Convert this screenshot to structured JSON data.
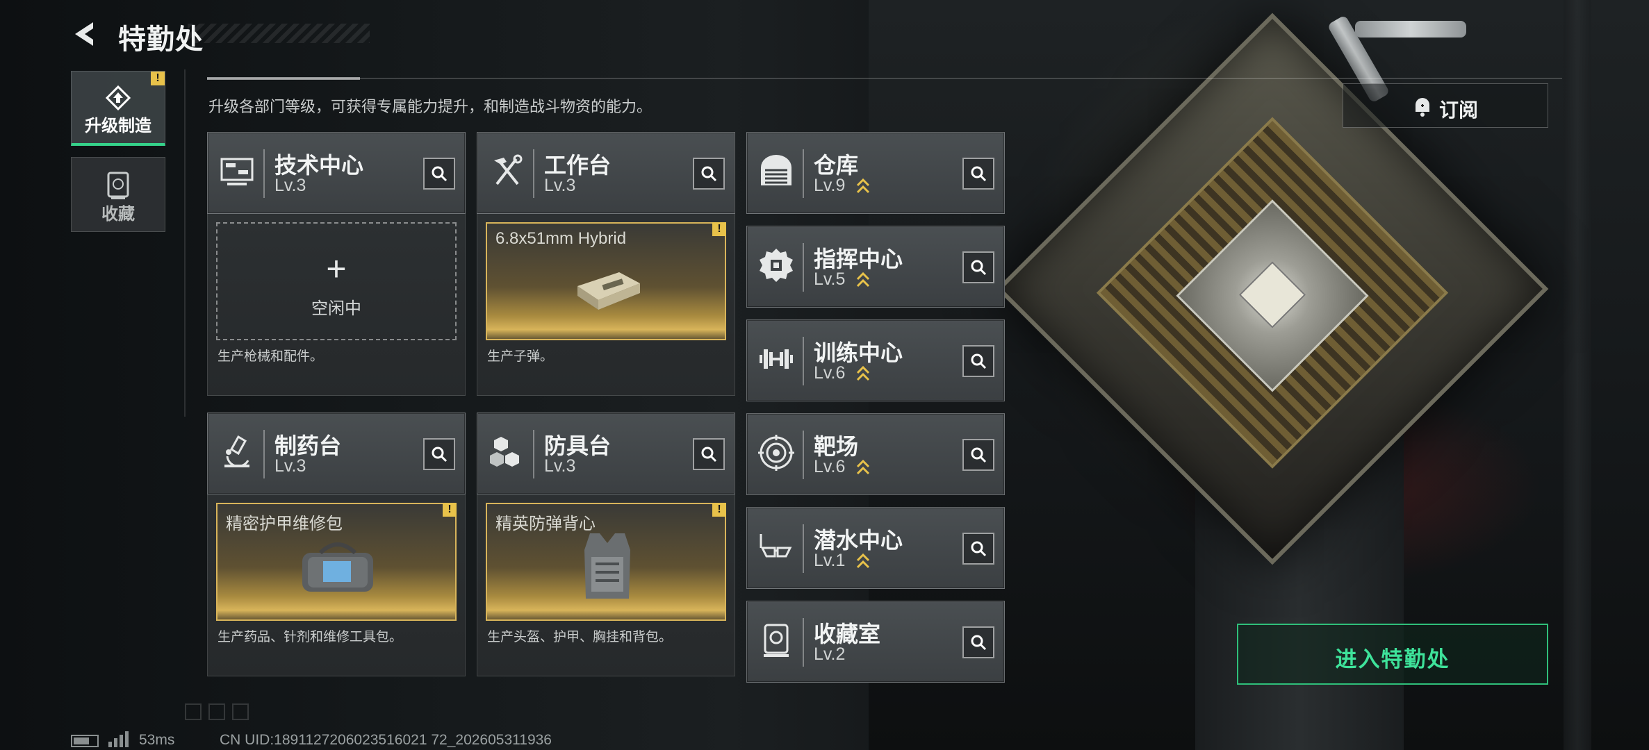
{
  "header": {
    "title": "特勤处",
    "subtitle": "升级各部门等级，可获得专属能力提升，和制造战斗物资的能力。"
  },
  "side_nav": [
    {
      "label": "升级制造",
      "icon": "upgrade-icon",
      "active": true,
      "badge": "!"
    },
    {
      "label": "收藏",
      "icon": "collection-icon",
      "active": false
    }
  ],
  "facilities_left": [
    {
      "name": "技术中心",
      "level": "Lv.3",
      "icon": "tech-center-icon",
      "slot": {
        "state": "empty",
        "plus": "+",
        "status": "空闲中"
      },
      "desc": "生产枪械和配件。"
    },
    {
      "name": "工作台",
      "level": "Lv.3",
      "icon": "hammer-wrench-icon",
      "slot": {
        "state": "producing",
        "item": "6.8x51mm Hybrid",
        "item_icon": "ammo-box-icon",
        "badge": "!"
      },
      "desc": "生产子弹。"
    },
    {
      "name": "制药台",
      "level": "Lv.3",
      "icon": "microscope-icon",
      "slot": {
        "state": "producing",
        "item": "精密护甲维修包",
        "item_icon": "repair-kit-icon",
        "badge": "!"
      },
      "desc": "生产药品、针剂和维修工具包。"
    },
    {
      "name": "防具台",
      "level": "Lv.3",
      "icon": "armor-cubes-icon",
      "slot": {
        "state": "producing",
        "item": "精英防弹背心",
        "item_icon": "vest-icon",
        "badge": "!"
      },
      "desc": "生产头盔、护甲、胸挂和背包。"
    }
  ],
  "facilities_right": [
    {
      "name": "仓库",
      "level": "Lv.9",
      "icon": "warehouse-icon",
      "upgradable": true
    },
    {
      "name": "指挥中心",
      "level": "Lv.5",
      "icon": "command-chip-icon",
      "upgradable": true
    },
    {
      "name": "训练中心",
      "level": "Lv.6",
      "icon": "dumbbell-icon",
      "upgradable": true
    },
    {
      "name": "靶场",
      "level": "Lv.6",
      "icon": "target-icon",
      "upgradable": true
    },
    {
      "name": "潜水中心",
      "level": "Lv.1",
      "icon": "diving-mask-icon",
      "upgradable": true
    },
    {
      "name": "收藏室",
      "level": "Lv.2",
      "icon": "collection-room-icon",
      "upgradable": false
    }
  ],
  "actions": {
    "subscribe_label": "订阅",
    "enter_label": "进入特勤处"
  },
  "status_bar": {
    "ping": "53ms",
    "uid": "CN UID:1891127206023516021 72_202605311936"
  },
  "colors": {
    "accent_green": "#3ee29a",
    "upgrade_gold": "#e8c24a",
    "slot_gold": "#d8b45a"
  }
}
